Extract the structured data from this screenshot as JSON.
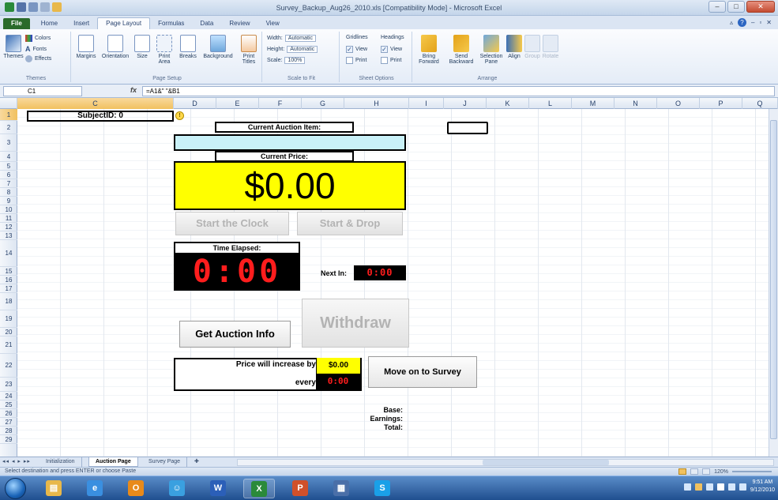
{
  "window": {
    "title": "Survey_Backup_Aug26_2010.xls [Compatibility Mode] - Microsoft Excel",
    "controls": {
      "minimize": "–",
      "maximize": "□",
      "close": "✕"
    }
  },
  "ribbon": {
    "tabs": [
      "File",
      "Home",
      "Insert",
      "Page Layout",
      "Formulas",
      "Data",
      "Review",
      "View"
    ],
    "active_tab": "Page Layout",
    "groups": {
      "themes": {
        "label": "Themes",
        "themes_button": "Themes",
        "colors": "Colors",
        "fonts": "Fonts",
        "effects": "Effects"
      },
      "page_setup": {
        "label": "Page Setup",
        "margins": "Margins",
        "orientation": "Orientation",
        "size": "Size",
        "print_area": "Print Area",
        "breaks": "Breaks",
        "background": "Background",
        "print_titles": "Print Titles"
      },
      "scale_to_fit": {
        "label": "Scale to Fit",
        "width_label": "Width:",
        "width_value": "Automatic",
        "height_label": "Height:",
        "height_value": "Automatic",
        "scale_label": "Scale:",
        "scale_value": "100%"
      },
      "sheet_options": {
        "label": "Sheet Options",
        "gridlines": "Gridlines",
        "headings": "Headings",
        "view": "View",
        "print": "Print"
      },
      "arrange": {
        "label": "Arrange",
        "bring_forward": "Bring Forward",
        "send_backward": "Send Backward",
        "selection_pane": "Selection Pane",
        "align": "Align",
        "group": "Group",
        "rotate": "Rotate"
      }
    }
  },
  "formula_bar": {
    "name_box": "C1",
    "fx": "fx",
    "formula": "=A1&\" \"&B1"
  },
  "grid": {
    "columns": [
      "C",
      "D",
      "E",
      "F",
      "G",
      "H",
      "I",
      "J",
      "K",
      "L",
      "M",
      "N",
      "O",
      "P",
      "Q"
    ],
    "selected_column": "C",
    "rows": [
      "1",
      "2",
      "3",
      "4",
      "5",
      "6",
      "7",
      "8",
      "9",
      "10",
      "11",
      "12",
      "13",
      "14",
      "15",
      "16",
      "17",
      "18",
      "19",
      "20",
      "21",
      "22",
      "23",
      "24",
      "25",
      "26",
      "27",
      "28",
      "29"
    ],
    "selected_row": "1"
  },
  "auction": {
    "subject_id": "SubjectID: 0",
    "current_item_label": "Current Auction Item:",
    "current_item_value": "",
    "current_price_label": "Current Price:",
    "current_price": "$0.00",
    "start_clock": "Start the Clock",
    "start_drop": "Start & Drop",
    "time_elapsed_label": "Time Elapsed:",
    "time_elapsed": "0:00",
    "next_in_label": "Next In:",
    "next_in": "0:00",
    "get_auction_info": "Get Auction Info",
    "withdraw": "Withdraw",
    "price_increase_label": "Price will increase by",
    "price_increase_value": "$0.00",
    "every_label": "every",
    "every_value": "0:00",
    "move_on": "Move on to Survey",
    "base_label": "Base:",
    "earnings_label": "Earnings:",
    "total_label": "Total:"
  },
  "sheet_tabs": {
    "tabs": [
      "Initialization",
      "Auction Page",
      "Survey Page"
    ],
    "active": "Auction Page"
  },
  "status_bar": {
    "text": "Select destination and press ENTER or choose Paste",
    "zoom": "120%"
  },
  "taskbar": {
    "apps": [
      {
        "name": "Explorer",
        "glyph": "▤",
        "color": "#e8b84a"
      },
      {
        "name": "Internet Explorer",
        "glyph": "e",
        "color": "#3a8fe0"
      },
      {
        "name": "Outlook",
        "glyph": "O",
        "color": "#e88a1a"
      },
      {
        "name": "Messenger",
        "glyph": "☺",
        "color": "#3aa0e0"
      },
      {
        "name": "Word",
        "glyph": "W",
        "color": "#2b5fb8"
      },
      {
        "name": "Excel",
        "glyph": "X",
        "color": "#2a8a3a"
      },
      {
        "name": "PowerPoint",
        "glyph": "P",
        "color": "#d0502a"
      },
      {
        "name": "Calculator",
        "glyph": "▦",
        "color": "#4a6fa8"
      },
      {
        "name": "Skype",
        "glyph": "S",
        "color": "#1aa0e8"
      }
    ],
    "time": "9:51 AM",
    "date": "9/12/2010"
  }
}
